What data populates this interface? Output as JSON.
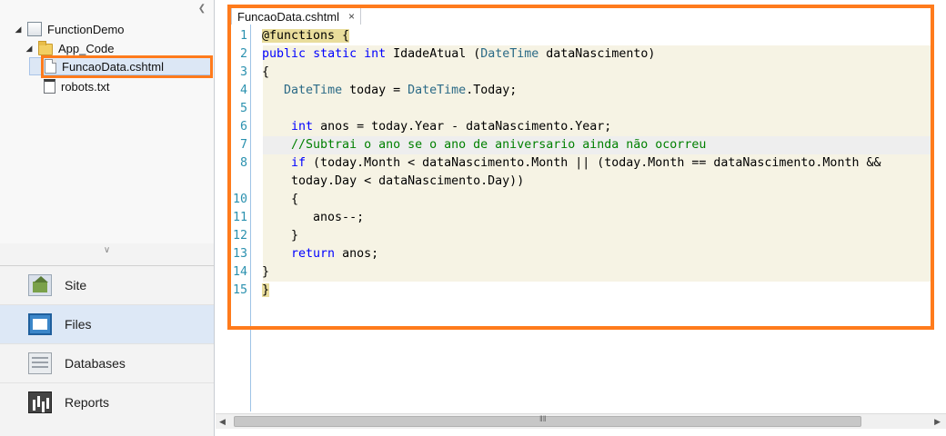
{
  "tree": {
    "project": "FunctionDemo",
    "folder": "App_Code",
    "selected_file": "FuncaoData.cshtml",
    "other_file": "robots.txt"
  },
  "nav": [
    {
      "label": "Site",
      "icon": "site-icon"
    },
    {
      "label": "Files",
      "icon": "files-icon"
    },
    {
      "label": "Databases",
      "icon": "databases-icon"
    },
    {
      "label": "Reports",
      "icon": "reports-icon"
    }
  ],
  "active_nav": "Files",
  "editor": {
    "tab_label": "FuncaoData.cshtml",
    "tab_close": "×",
    "current_line": 7,
    "lines": [
      {
        "n": "1",
        "text": "@functions {"
      },
      {
        "n": "2",
        "text": "public static int IdadeAtual (DateTime dataNascimento)"
      },
      {
        "n": "3",
        "text": "{"
      },
      {
        "n": "4",
        "text": "   DateTime today = DateTime.Today;"
      },
      {
        "n": "5",
        "text": ""
      },
      {
        "n": "6",
        "text": "    int anos = today.Year - dataNascimento.Year;"
      },
      {
        "n": "7",
        "text": "    //Subtrai o ano se o ano de aniversario ainda não ocorreu"
      },
      {
        "n": "8",
        "text": "    if (today.Month < dataNascimento.Month || (today.Month == dataNascimento.Month &&"
      },
      {
        "n": "",
        "text": "    today.Day < dataNascimento.Day))"
      },
      {
        "n": "10",
        "text": "    {"
      },
      {
        "n": "11",
        "text": "       anos--;"
      },
      {
        "n": "12",
        "text": "    }"
      },
      {
        "n": "13",
        "text": "    return anos;"
      },
      {
        "n": "14",
        "text": "}"
      },
      {
        "n": "15",
        "text": "}"
      }
    ]
  },
  "colors": {
    "highlight": "#ff7b1c",
    "keyword": "#0000ff",
    "type": "#2b6a86",
    "comment": "#008000",
    "line_number": "#2b91af",
    "server_block": "#f6f3e4"
  }
}
